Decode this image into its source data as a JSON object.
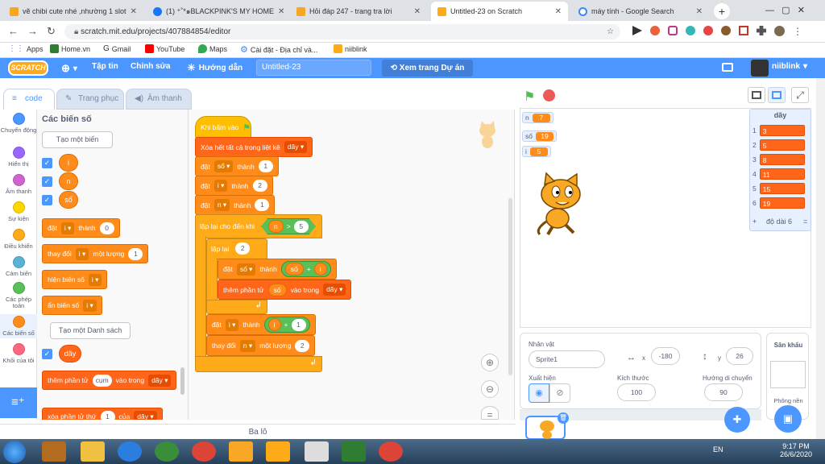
{
  "browser": {
    "tabs": [
      {
        "title": "vẽ chibi cute nhé ,nhường 1 slot",
        "fav": "#f5a623"
      },
      {
        "title": "(1) ⁺˚*๑BLACKPINK'S MY HOME",
        "fav": "#1877f2"
      },
      {
        "title": "Hỏi đáp 247 - trang tra lời",
        "fav": "#f5a623"
      },
      {
        "title": "Untitled-23 on Scratch",
        "fav": "#ffab19"
      },
      {
        "title": "máy tính - Google Search",
        "fav": "#4285f4"
      }
    ],
    "url": "scratch.mit.edu/projects/407884854/editor",
    "bookmarks": [
      "Apps",
      "Home.vn",
      "Gmail",
      "YouTube",
      "Maps",
      "Cài đặt - Địa chỉ và...",
      "niiblink"
    ]
  },
  "menu": {
    "logo": "SCRATCH",
    "file": "Tập tin",
    "edit": "Chỉnh sửa",
    "tutorial": "Hướng dẫn",
    "project_title": "Untitled-23",
    "see_project": "Xem trang Dự án",
    "user": "niiblink"
  },
  "editor_tabs": {
    "code": "code",
    "costumes": "Trang phục",
    "sounds": "Âm thanh"
  },
  "categories": [
    {
      "label": "Chuyển động",
      "color": "#4c97ff"
    },
    {
      "label": "Hiển thị",
      "color": "#9966ff"
    },
    {
      "label": "Âm thanh",
      "color": "#cf63cf"
    },
    {
      "label": "Sự kiện",
      "color": "#ffd500"
    },
    {
      "label": "Điều khiển",
      "color": "#ffab19"
    },
    {
      "label": "Cảm biến",
      "color": "#5cb1d6"
    },
    {
      "label": "Các phép toán",
      "color": "#59c059"
    },
    {
      "label": "Các biến số",
      "color": "#ff8c1a"
    },
    {
      "label": "Khối của tôi",
      "color": "#ff6680"
    }
  ],
  "palette": {
    "title": "Các biến số",
    "make_var": "Tạo một biến",
    "vars": [
      "i",
      "n",
      "số"
    ],
    "set": {
      "w1": "đặt",
      "var": "i",
      "w2": "thành",
      "val": "0"
    },
    "change": {
      "w1": "thay đổi",
      "var": "i",
      "w2": "một lượng",
      "val": "1"
    },
    "show": {
      "w1": "hiện biến số",
      "var": "i"
    },
    "hide": {
      "w1": "ẩn biến số",
      "var": "i"
    },
    "make_list": "Tạo một Danh sách",
    "list": "dãy",
    "add": {
      "w1": "thêm phần tử",
      "val": "cụm",
      "w2": "vào trong",
      "list": "dãy"
    },
    "delete": {
      "w1": "xóa phần tử thứ",
      "val": "1",
      "w2": "của",
      "list": "dãy"
    }
  },
  "script": {
    "hat": "Khi bấm vào",
    "clear": {
      "text": "Xóa hết tất cả trong liệt kê",
      "list": "dãy"
    },
    "set1": {
      "w1": "đặt",
      "var": "số",
      "w2": "thành",
      "val": "1"
    },
    "set2": {
      "w1": "đặt",
      "var": "i",
      "w2": "thành",
      "val": "2"
    },
    "set3": {
      "w1": "đặt",
      "var": "n",
      "w2": "thành",
      "val": "1"
    },
    "until": {
      "text": "lặp lại cho đến khi",
      "left": "n",
      "op": ">",
      "right": "5"
    },
    "repeat": {
      "text": "lặp lại",
      "val": "2"
    },
    "set4": {
      "w1": "đặt",
      "var": "số",
      "w2": "thành",
      "a": "số",
      "op": "+",
      "b": "i"
    },
    "add": {
      "w1": "thêm phần tử",
      "val": "số",
      "w2": "vào trong",
      "list": "dãy"
    },
    "set5": {
      "w1": "đặt",
      "var": "i",
      "w2": "thành",
      "a": "i",
      "op": "+",
      "b": "1"
    },
    "change": {
      "w1": "thay đổi",
      "var": "n",
      "w2": "một lượng",
      "val": "2"
    }
  },
  "stage": {
    "monitors": [
      {
        "name": "n",
        "value": "7"
      },
      {
        "name": "số",
        "value": "19"
      },
      {
        "name": "i",
        "value": "5"
      }
    ],
    "list": {
      "title": "dãy",
      "items": [
        "3",
        "5",
        "8",
        "11",
        "15",
        "19"
      ],
      "indexes": [
        "1",
        "2",
        "3",
        "4",
        "5",
        "6"
      ],
      "add": "+",
      "length": "độ dài 6",
      "eq": "="
    }
  },
  "sprite": {
    "label": "Nhân vật",
    "name": "Sprite1",
    "x_label": "x",
    "x": "-180",
    "y_label": "y",
    "y": "26",
    "show": "Xuất hiện",
    "size_label": "Kích thước",
    "size": "100",
    "dir_label": "Hướng di chuyển",
    "dir": "90"
  },
  "stage_panel": {
    "label": "Sân khấu",
    "backdrops": "Phông nền"
  },
  "backpack": "Ba lô",
  "taskbar": {
    "lang": "EN",
    "time": "9:17 PM",
    "date": "26/6/2020"
  },
  "colors": {
    "accent": "#4c97ff",
    "variables": "#ff8c1a",
    "list": "#ff661a",
    "control": "#ffab19",
    "operators": "#59c059"
  }
}
